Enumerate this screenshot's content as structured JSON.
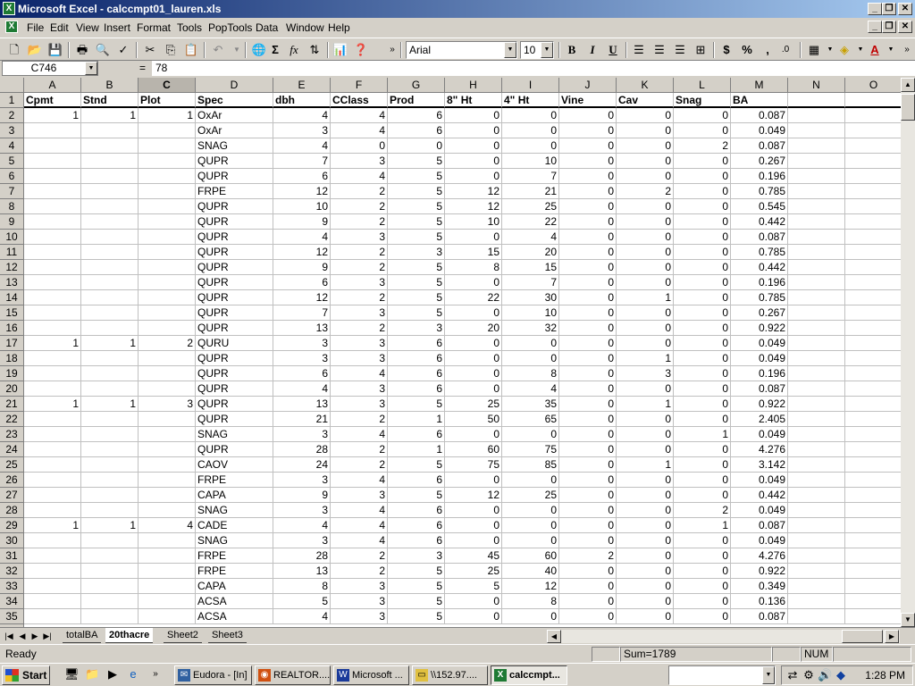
{
  "window": {
    "title": "Microsoft Excel - calccmpt01_lauren.xls",
    "app_icon": "X"
  },
  "menu": [
    "File",
    "Edit",
    "View",
    "Insert",
    "Format",
    "Tools",
    "PopTools",
    "Data",
    "Window",
    "Help"
  ],
  "toolbar": {
    "font_name": "Arial",
    "font_size": "10",
    "sum_symbol": "Σ",
    "fx_symbol": "fx",
    "bold": "B",
    "italic": "I",
    "underline": "U",
    "currency": "$",
    "percent": "%",
    "comma": ",",
    "inc_decimal": ".0",
    "font_color_label": "A"
  },
  "formula_bar": {
    "name_box": "C746",
    "equals": "=",
    "value": "78"
  },
  "columns": [
    {
      "letter": "A",
      "header": "Cpmt"
    },
    {
      "letter": "B",
      "header": "Stnd"
    },
    {
      "letter": "C",
      "header": "Plot"
    },
    {
      "letter": "D",
      "header": "Spec"
    },
    {
      "letter": "E",
      "header": "dbh"
    },
    {
      "letter": "F",
      "header": "CClass"
    },
    {
      "letter": "G",
      "header": "Prod"
    },
    {
      "letter": "H",
      "header": "8\" Ht"
    },
    {
      "letter": "I",
      "header": "4\" Ht"
    },
    {
      "letter": "J",
      "header": "Vine"
    },
    {
      "letter": "K",
      "header": "Cav"
    },
    {
      "letter": "L",
      "header": "Snag"
    },
    {
      "letter": "M",
      "header": "BA"
    },
    {
      "letter": "N",
      "header": ""
    },
    {
      "letter": "O",
      "header": ""
    }
  ],
  "rows": [
    [
      "1",
      "1",
      "1",
      "OxAr",
      "4",
      "4",
      "6",
      "0",
      "0",
      "0",
      "0",
      "0",
      "0.087"
    ],
    [
      "",
      "",
      "",
      "OxAr",
      "3",
      "4",
      "6",
      "0",
      "0",
      "0",
      "0",
      "0",
      "0.049"
    ],
    [
      "",
      "",
      "",
      "SNAG",
      "4",
      "0",
      "0",
      "0",
      "0",
      "0",
      "0",
      "2",
      "0.087"
    ],
    [
      "",
      "",
      "",
      "QUPR",
      "7",
      "3",
      "5",
      "0",
      "10",
      "0",
      "0",
      "0",
      "0.267"
    ],
    [
      "",
      "",
      "",
      "QUPR",
      "6",
      "4",
      "5",
      "0",
      "7",
      "0",
      "0",
      "0",
      "0.196"
    ],
    [
      "",
      "",
      "",
      "FRPE",
      "12",
      "2",
      "5",
      "12",
      "21",
      "0",
      "2",
      "0",
      "0.785"
    ],
    [
      "",
      "",
      "",
      "QUPR",
      "10",
      "2",
      "5",
      "12",
      "25",
      "0",
      "0",
      "0",
      "0.545"
    ],
    [
      "",
      "",
      "",
      "QUPR",
      "9",
      "2",
      "5",
      "10",
      "22",
      "0",
      "0",
      "0",
      "0.442"
    ],
    [
      "",
      "",
      "",
      "QUPR",
      "4",
      "3",
      "5",
      "0",
      "4",
      "0",
      "0",
      "0",
      "0.087"
    ],
    [
      "",
      "",
      "",
      "QUPR",
      "12",
      "2",
      "3",
      "15",
      "20",
      "0",
      "0",
      "0",
      "0.785"
    ],
    [
      "",
      "",
      "",
      "QUPR",
      "9",
      "2",
      "5",
      "8",
      "15",
      "0",
      "0",
      "0",
      "0.442"
    ],
    [
      "",
      "",
      "",
      "QUPR",
      "6",
      "3",
      "5",
      "0",
      "7",
      "0",
      "0",
      "0",
      "0.196"
    ],
    [
      "",
      "",
      "",
      "QUPR",
      "12",
      "2",
      "5",
      "22",
      "30",
      "0",
      "1",
      "0",
      "0.785"
    ],
    [
      "",
      "",
      "",
      "QUPR",
      "7",
      "3",
      "5",
      "0",
      "10",
      "0",
      "0",
      "0",
      "0.267"
    ],
    [
      "",
      "",
      "",
      "QUPR",
      "13",
      "2",
      "3",
      "20",
      "32",
      "0",
      "0",
      "0",
      "0.922"
    ],
    [
      "1",
      "1",
      "2",
      "QURU",
      "3",
      "3",
      "6",
      "0",
      "0",
      "0",
      "0",
      "0",
      "0.049"
    ],
    [
      "",
      "",
      "",
      "QUPR",
      "3",
      "3",
      "6",
      "0",
      "0",
      "0",
      "1",
      "0",
      "0.049"
    ],
    [
      "",
      "",
      "",
      "QUPR",
      "6",
      "4",
      "6",
      "0",
      "8",
      "0",
      "3",
      "0",
      "0.196"
    ],
    [
      "",
      "",
      "",
      "QUPR",
      "4",
      "3",
      "6",
      "0",
      "4",
      "0",
      "0",
      "0",
      "0.087"
    ],
    [
      "1",
      "1",
      "3",
      "QUPR",
      "13",
      "3",
      "5",
      "25",
      "35",
      "0",
      "1",
      "0",
      "0.922"
    ],
    [
      "",
      "",
      "",
      "QUPR",
      "21",
      "2",
      "1",
      "50",
      "65",
      "0",
      "0",
      "0",
      "2.405"
    ],
    [
      "",
      "",
      "",
      "SNAG",
      "3",
      "4",
      "6",
      "0",
      "0",
      "0",
      "0",
      "1",
      "0.049"
    ],
    [
      "",
      "",
      "",
      "QUPR",
      "28",
      "2",
      "1",
      "60",
      "75",
      "0",
      "0",
      "0",
      "4.276"
    ],
    [
      "",
      "",
      "",
      "CAOV",
      "24",
      "2",
      "5",
      "75",
      "85",
      "0",
      "1",
      "0",
      "3.142"
    ],
    [
      "",
      "",
      "",
      "FRPE",
      "3",
      "4",
      "6",
      "0",
      "0",
      "0",
      "0",
      "0",
      "0.049"
    ],
    [
      "",
      "",
      "",
      "CAPA",
      "9",
      "3",
      "5",
      "12",
      "25",
      "0",
      "0",
      "0",
      "0.442"
    ],
    [
      "",
      "",
      "",
      "SNAG",
      "3",
      "4",
      "6",
      "0",
      "0",
      "0",
      "0",
      "2",
      "0.049"
    ],
    [
      "1",
      "1",
      "4",
      "CADE",
      "4",
      "4",
      "6",
      "0",
      "0",
      "0",
      "0",
      "1",
      "0.087"
    ],
    [
      "",
      "",
      "",
      "SNAG",
      "3",
      "4",
      "6",
      "0",
      "0",
      "0",
      "0",
      "0",
      "0.049"
    ],
    [
      "",
      "",
      "",
      "FRPE",
      "28",
      "2",
      "3",
      "45",
      "60",
      "2",
      "0",
      "0",
      "4.276"
    ],
    [
      "",
      "",
      "",
      "FRPE",
      "13",
      "2",
      "5",
      "25",
      "40",
      "0",
      "0",
      "0",
      "0.922"
    ],
    [
      "",
      "",
      "",
      "CAPA",
      "8",
      "3",
      "5",
      "5",
      "12",
      "0",
      "0",
      "0",
      "0.349"
    ],
    [
      "",
      "",
      "",
      "ACSA",
      "5",
      "3",
      "5",
      "0",
      "8",
      "0",
      "0",
      "0",
      "0.136"
    ],
    [
      "",
      "",
      "",
      "ACSA",
      "4",
      "3",
      "5",
      "0",
      "0",
      "0",
      "0",
      "0",
      "0.087"
    ]
  ],
  "sheet_tabs": [
    "totalBA",
    "20thacre",
    "Sheet2",
    "Sheet3"
  ],
  "active_tab": "20thacre",
  "status": {
    "ready": "Ready",
    "sum": "Sum=1789",
    "num": "NUM"
  },
  "taskbar": {
    "start": "Start",
    "tasks": [
      "Eudora - [In]",
      "REALTOR....",
      "Microsoft ...",
      "\\\\152.97....",
      "calccmpt..."
    ],
    "clock": "1:28 PM"
  }
}
